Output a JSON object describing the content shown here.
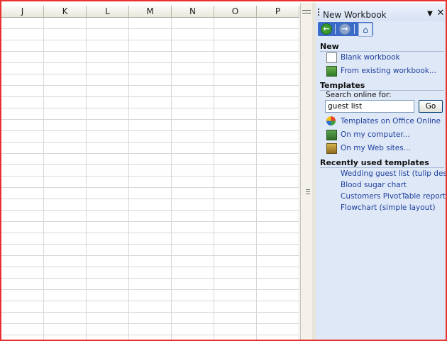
{
  "sheet": {
    "columns": [
      "J",
      "K",
      "L",
      "M",
      "N",
      "O",
      "P"
    ]
  },
  "task_pane": {
    "title": "New Workbook",
    "new_section": {
      "heading": "New",
      "blank_workbook": "Blank workbook",
      "from_existing": "From existing workbook..."
    },
    "templates_section": {
      "heading": "Templates",
      "search_label": "Search online for:",
      "search_value": "guest list",
      "go_label": "Go",
      "templates_online": "Templates on Office Online",
      "on_my_computer": "On my computer...",
      "on_my_web_sites": "On my Web sites..."
    },
    "recent_section": {
      "heading": "Recently used templates",
      "items": [
        "Wedding guest list (tulip design)",
        "Blood sugar chart",
        "Customers PivotTable report",
        "Flowchart (simple layout)"
      ]
    }
  }
}
